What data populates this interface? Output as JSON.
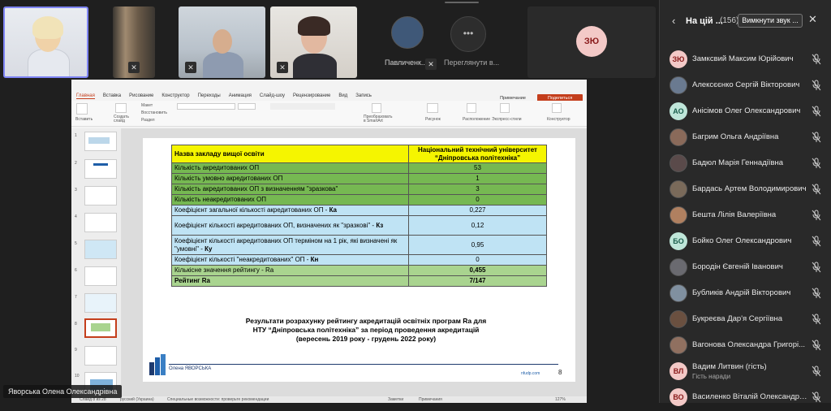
{
  "video_tiles": [
    {
      "type": "video",
      "muted": true
    },
    {
      "type": "video",
      "muted": true
    },
    {
      "type": "video",
      "muted": true
    },
    {
      "type": "video",
      "muted": true
    },
    {
      "type": "photo",
      "name": "Павличенк...",
      "muted": true
    },
    {
      "type": "more",
      "label": "Переглянути в..."
    },
    {
      "type": "initials",
      "initials": "ЗЮ"
    }
  ],
  "ppt": {
    "tabs": [
      "Главная",
      "Вставка",
      "Рисование",
      "Конструктор",
      "Переходы",
      "Анимация",
      "Слайд-шоу",
      "Рецензирование",
      "Вид",
      "Запись"
    ],
    "notes_button": "Примечание",
    "share_button": "Поделиться",
    "ribbon": {
      "paste": "Вставить",
      "new_slide": "Создать слайд",
      "layout": "Макет",
      "reset": "Восстановить",
      "section": "Раздел",
      "convert_smartart": "Преобразовать в SmartArt",
      "picture": "Рисунок",
      "arrange": "Расположение",
      "quick_styles": "Экспресс-стили",
      "designer": "Конструктор"
    },
    "thumb_numbers": [
      "1",
      "2",
      "3",
      "4",
      "5",
      "6",
      "7",
      "8",
      "9",
      "10"
    ],
    "status": {
      "slide": "Слайд 8 из 28",
      "language": "русский (Украина)",
      "accessibility": "Специальные возможности: проверьте рекомендации",
      "notes": "Заметки",
      "comments": "Примечания",
      "zoom": "127%"
    }
  },
  "slide": {
    "table": {
      "header": [
        "Назва закладу вищої освіти",
        "Національний технічний університет “Дніпровська політехніка”"
      ],
      "rows": [
        {
          "label": "Кількість акредитованих ОП",
          "value": "53",
          "style": "g"
        },
        {
          "label": "Кількість умовно акредитованих ОП",
          "value": "1",
          "style": "g"
        },
        {
          "label": "Кількість акредитованих ОП з визначенням \"зразкова\"",
          "value": "3",
          "style": "g"
        },
        {
          "label": "Кількість неакредитованих ОП",
          "value": "0",
          "style": "g"
        },
        {
          "label": "Коефіцієнт загальної кількості акредитованих ОП - ",
          "bold": "Ка",
          "value": "0,227",
          "style": "b"
        },
        {
          "label": "Коефіцієнт кількості акредитованих ОП, визначених як \"зразкові\" - ",
          "bold": "Кз",
          "value": "0,12",
          "style": "b"
        },
        {
          "label": "Коефіцієнт кількості акредитованих ОП терміном на 1 рік, які визначені як \"умовні\" - ",
          "bold": "Ку",
          "value": "0,95",
          "style": "b"
        },
        {
          "label": "Коефіцієнт кількості \"неакредитованих\" ОП - ",
          "bold": "Кн",
          "value": "0",
          "style": "b"
        },
        {
          "label": "Кількісне значення рейтингу - Ra",
          "value": "0,455",
          "style": "g2"
        },
        {
          "label": "Рейтинг Ra",
          "value": "7/147",
          "style": "g2"
        }
      ]
    },
    "caption_lines": [
      "Результати розрахунку рейтингу акредитацій освітніх програм Ra для",
      "НТУ “Дніпровська політехніка” за період проведення акредитацій",
      "(вересень 2019 року - грудень 2022 року)"
    ],
    "author": "Олена ЯВОРСЬКА",
    "url": "nfudp.com",
    "page_number": "8"
  },
  "speaker_name": "Яворська Олена Олександрівна",
  "panel": {
    "title": "На цій ...",
    "count": "(156)",
    "mute_all": "Вимкнути звук ...",
    "participants": [
      {
        "name": "Замксвий Максим Юрійович",
        "initials": "ЗЮ",
        "av": "#f3c9c7",
        "fg": "#8a1b1b",
        "photo": false
      },
      {
        "name": "Алексєєнко Сергій Вікторович",
        "photo": true,
        "av": "#6a7a90"
      },
      {
        "name": "Анісімов Олег Олександрович",
        "initials": "АО",
        "av": "#bfe6d9",
        "fg": "#1a5e4c",
        "photo": false
      },
      {
        "name": "Багрим Ольга Андріївна",
        "photo": true,
        "av": "#8a6a5a"
      },
      {
        "name": "Бадюл Марія Геннадіївна",
        "photo": true,
        "av": "#5a4a4a"
      },
      {
        "name": "Бардась Артем Володимирович",
        "photo": true,
        "av": "#7a6a5a"
      },
      {
        "name": "Бешта Лілія Валеріївна",
        "photo": true,
        "av": "#b08060"
      },
      {
        "name": "Бойко Олег Олександрович",
        "initials": "БО",
        "av": "#bfe6d9",
        "fg": "#1a5e4c",
        "photo": false
      },
      {
        "name": "Бородін Євгеній Іванович",
        "photo": true,
        "av": "#6a6a70"
      },
      {
        "name": "Бубликів Андрій Вікторович",
        "photo": true,
        "av": "#8090a0"
      },
      {
        "name": "Букреєва Дар'я Сергіївна",
        "photo": true,
        "av": "#6a5040"
      },
      {
        "name": "Вагонова Олександра Григорі...",
        "photo": true,
        "av": "#907060"
      },
      {
        "name": "Вадим Литвин (гість)",
        "sub": "Гість наради",
        "initials": "ВЛ",
        "av": "#f3c9c7",
        "fg": "#8a1b1b",
        "photo": false
      },
      {
        "name": "Василенко Віталій Олександро...",
        "initials": "ВО",
        "av": "#f3c9c7",
        "fg": "#8a1b1b",
        "photo": false
      }
    ]
  }
}
